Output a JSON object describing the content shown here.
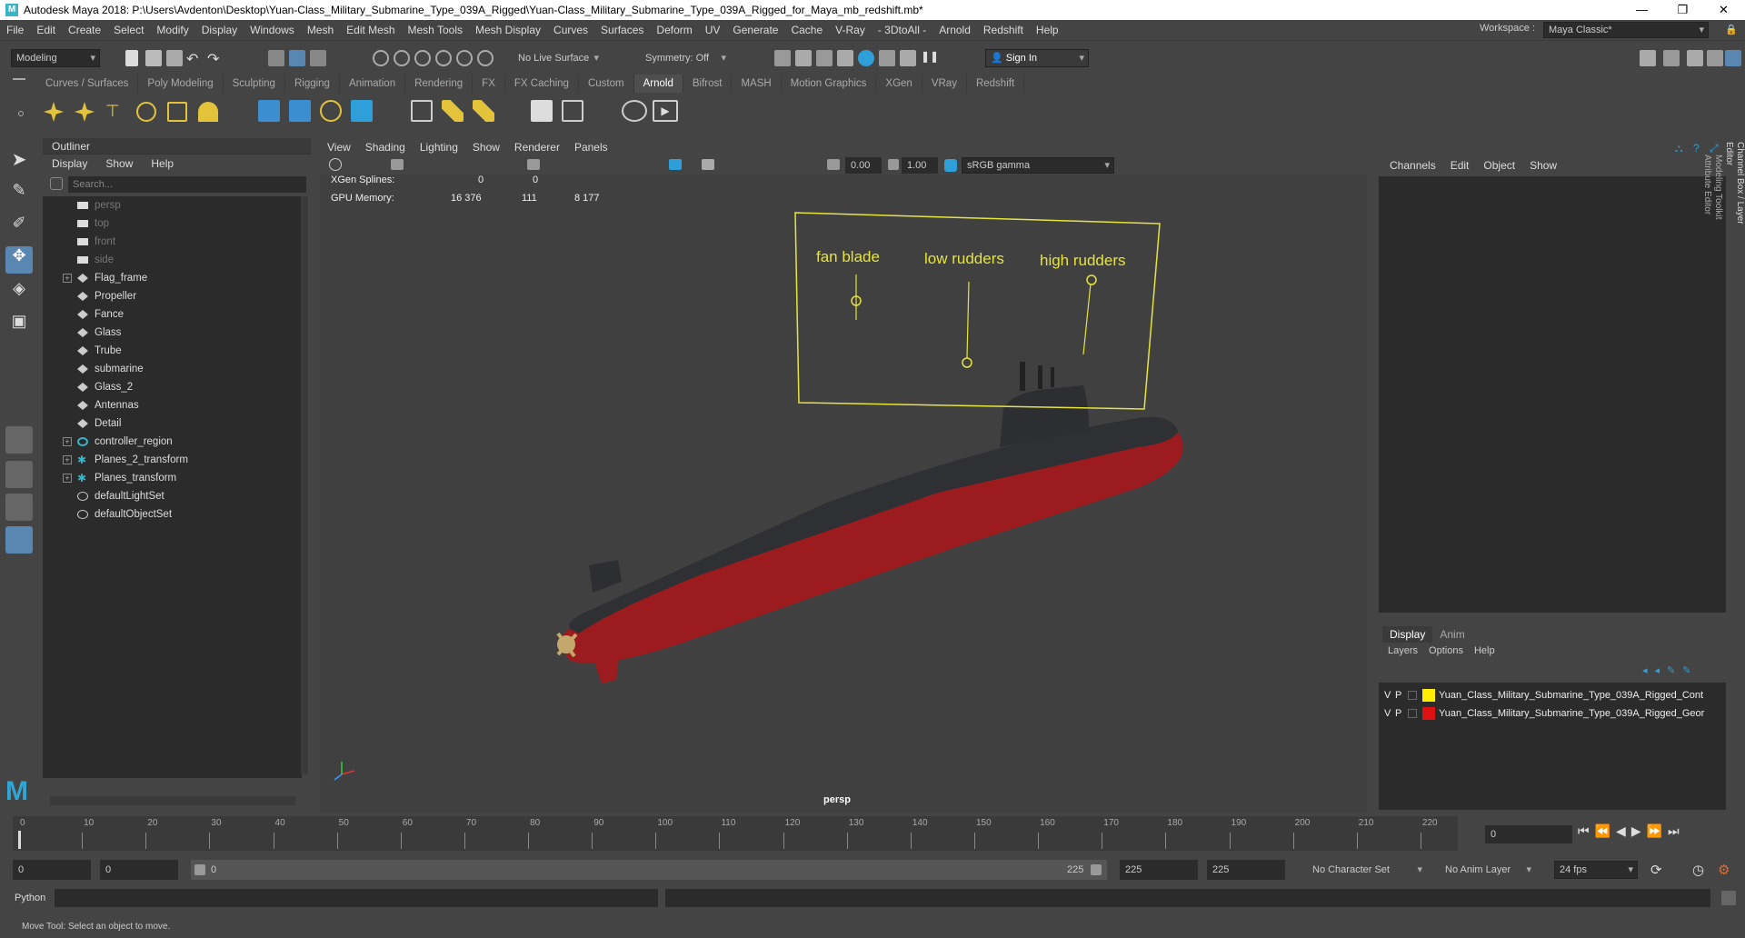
{
  "window": {
    "title": "Autodesk Maya 2018: P:\\Users\\Avdenton\\Desktop\\Yuan-Class_Military_Submarine_Type_039A_Rigged\\Yuan-Class_Military_Submarine_Type_039A_Rigged_for_Maya_mb_redshift.mb*",
    "workspace_label": "Workspace :",
    "workspace_value": "Maya Classic*"
  },
  "menu": [
    "File",
    "Edit",
    "Create",
    "Select",
    "Modify",
    "Display",
    "Windows",
    "Mesh",
    "Edit Mesh",
    "Mesh Tools",
    "Mesh Display",
    "Curves",
    "Surfaces",
    "Deform",
    "UV",
    "Generate",
    "Cache",
    "V-Ray",
    "- 3DtoAll -",
    "Arnold",
    "Redshift",
    "Help"
  ],
  "status": {
    "mode": "Modeling",
    "live_surface": "No Live Surface",
    "symmetry": "Symmetry: Off",
    "sign_in": "Sign In"
  },
  "shelf_tabs": [
    "Curves / Surfaces",
    "Poly Modeling",
    "Sculpting",
    "Rigging",
    "Animation",
    "Rendering",
    "FX",
    "FX Caching",
    "Custom",
    "Arnold",
    "Bifrost",
    "MASH",
    "Motion Graphics",
    "XGen",
    "VRay",
    "Redshift"
  ],
  "shelf_active": "Arnold",
  "outliner": {
    "title": "Outliner",
    "menu": [
      "Display",
      "Show",
      "Help"
    ],
    "search_placeholder": "Search...",
    "items": [
      {
        "label": "persp",
        "dim": true,
        "exp": false
      },
      {
        "label": "top",
        "dim": true,
        "exp": false
      },
      {
        "label": "front",
        "dim": true,
        "exp": false
      },
      {
        "label": "side",
        "dim": true,
        "exp": false
      },
      {
        "label": "Flag_frame",
        "dim": false,
        "exp": true
      },
      {
        "label": "Propeller",
        "dim": false,
        "exp": false
      },
      {
        "label": "Fance",
        "dim": false,
        "exp": false
      },
      {
        "label": "Glass",
        "dim": false,
        "exp": false
      },
      {
        "label": "Trube",
        "dim": false,
        "exp": false
      },
      {
        "label": "submarine",
        "dim": false,
        "exp": false
      },
      {
        "label": "Glass_2",
        "dim": false,
        "exp": false
      },
      {
        "label": "Antennas",
        "dim": false,
        "exp": false
      },
      {
        "label": "Detail",
        "dim": false,
        "exp": false
      },
      {
        "label": "controller_region",
        "dim": false,
        "exp": true
      },
      {
        "label": "Planes_2_transform",
        "dim": false,
        "exp": true
      },
      {
        "label": "Planes_transform",
        "dim": false,
        "exp": true
      },
      {
        "label": "defaultLightSet",
        "dim": false,
        "exp": false
      },
      {
        "label": "defaultObjectSet",
        "dim": false,
        "exp": false
      }
    ]
  },
  "viewport": {
    "menu": [
      "View",
      "Shading",
      "Lighting",
      "Show",
      "Renderer",
      "Panels"
    ],
    "exposure": "0.00",
    "gamma": "1.00",
    "colorspace": "sRGB gamma",
    "camera": "persp",
    "hud": {
      "xgen_label": "XGen Splines:",
      "xgen_a": "0",
      "xgen_b": "0",
      "gpu_label": "GPU Memory:",
      "gpu_a": "16 376",
      "gpu_b": "111",
      "gpu_c": "8 177"
    },
    "labels": {
      "fan": "fan blade",
      "low": "low rudders",
      "high": "high rudders"
    }
  },
  "channelbox": {
    "tabs": [
      "Channels",
      "Edit",
      "Object",
      "Show"
    ],
    "side_tabs": [
      "Channel Box / Layer Editor",
      "Modeling Toolkit",
      "Attribute Editor"
    ]
  },
  "layers": {
    "tabs": [
      "Display",
      "Anim"
    ],
    "menu": [
      "Layers",
      "Options",
      "Help"
    ],
    "rows": [
      {
        "v": "V",
        "p": "P",
        "color": "#ffee00",
        "name": "Yuan_Class_Military_Submarine_Type_039A_Rigged_Cont"
      },
      {
        "v": "V",
        "p": "P",
        "color": "#dd1111",
        "name": "Yuan_Class_Military_Submarine_Type_039A_Rigged_Geor"
      }
    ]
  },
  "timeline": {
    "ticks": [
      "0",
      "10",
      "20",
      "30",
      "40",
      "50",
      "60",
      "70",
      "80",
      "90",
      "100",
      "110",
      "120",
      "130",
      "140",
      "150",
      "160",
      "170",
      "180",
      "190",
      "200",
      "210",
      "220"
    ],
    "current": "0"
  },
  "range": {
    "start": "0",
    "anim_start": "0",
    "range_start": "0",
    "range_end": "225",
    "anim_end": "225",
    "end": "225",
    "character_set": "No Character Set",
    "anim_layer": "No Anim Layer",
    "fps": "24 fps"
  },
  "cmd": {
    "lang": "Python"
  },
  "help": "Move Tool: Select an object to move."
}
